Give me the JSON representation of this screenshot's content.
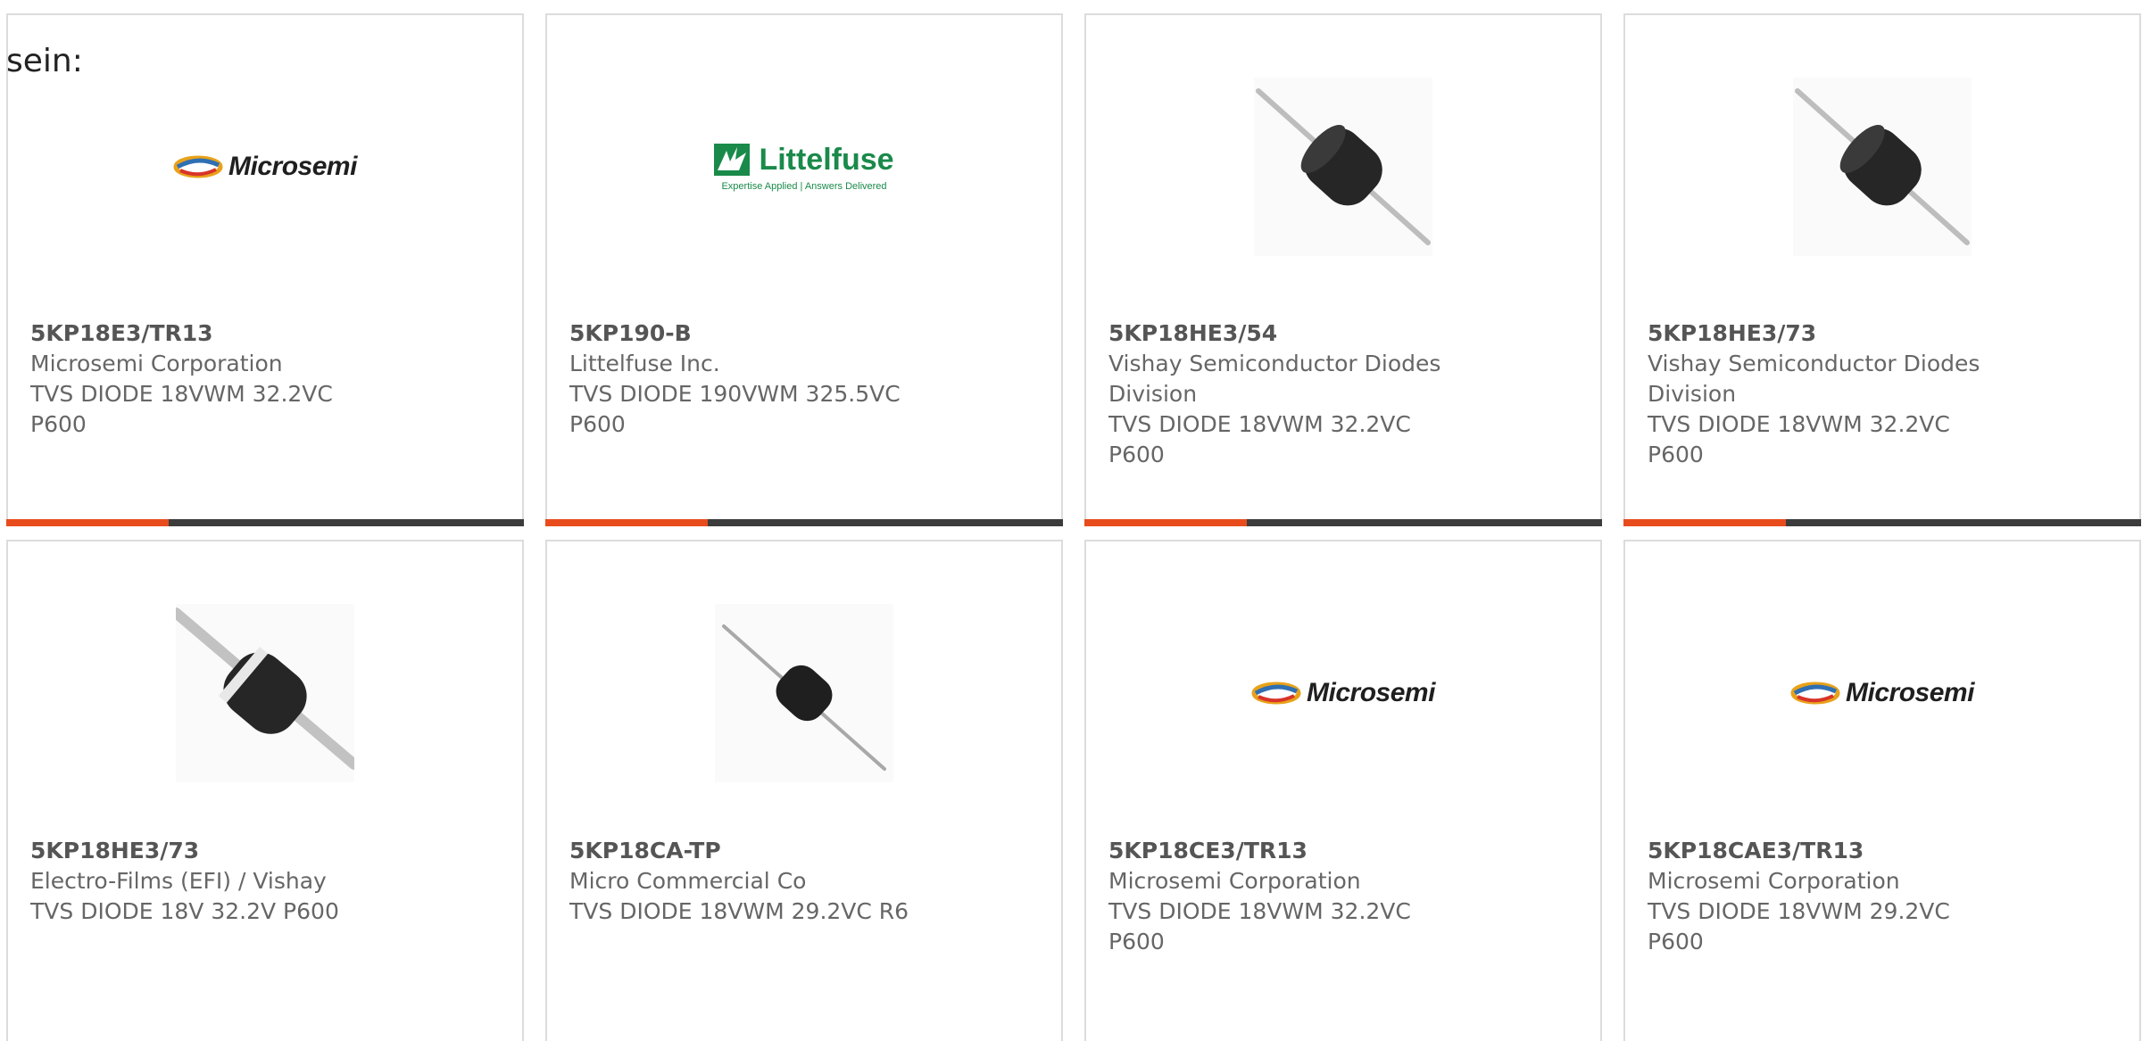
{
  "intro_text": "sein:",
  "colors": {
    "accent": "#e84c1d",
    "bar": "#3c3c3c",
    "border": "#dcdcdc",
    "text": "#666666"
  },
  "products": [
    {
      "part_number": "5KP18E3/TR13",
      "manufacturer": "Microsemi Corporation",
      "description": "TVS DIODE 18VWM 32.2VC P600",
      "image": "microsemi-logo",
      "logo_text": "Microsemi"
    },
    {
      "part_number": "5KP190-B",
      "manufacturer": "Littelfuse Inc.",
      "description": "TVS DIODE 190VWM 325.5VC P600",
      "image": "littelfuse-logo",
      "logo_text": "Littelfuse",
      "logo_tagline": "Expertise Applied | Answers Delivered"
    },
    {
      "part_number": "5KP18HE3/54",
      "manufacturer": "Vishay Semiconductor Diodes Division",
      "description": "TVS DIODE 18VWM 32.2VC P600",
      "image": "axial-diode-photo"
    },
    {
      "part_number": "5KP18HE3/73",
      "manufacturer": "Vishay Semiconductor Diodes Division",
      "description": "TVS DIODE 18VWM 32.2VC P600",
      "image": "axial-diode-photo"
    },
    {
      "part_number": "5KP18HE3/73",
      "manufacturer": "Electro-Films (EFI) / Vishay",
      "description": "TVS DIODE 18V 32.2V P600",
      "image": "axial-diode-band-photo"
    },
    {
      "part_number": "5KP18CA-TP",
      "manufacturer": "Micro Commercial Co",
      "description": "TVS DIODE 18VWM 29.2VC R6",
      "image": "axial-diode-small-photo"
    },
    {
      "part_number": "5KP18CE3/TR13",
      "manufacturer": "Microsemi Corporation",
      "description": "TVS DIODE 18VWM 32.2VC P600",
      "image": "microsemi-logo",
      "logo_text": "Microsemi"
    },
    {
      "part_number": "5KP18CAE3/TR13",
      "manufacturer": "Microsemi Corporation",
      "description": "TVS DIODE 18VWM 29.2VC P600",
      "image": "microsemi-logo",
      "logo_text": "Microsemi"
    }
  ]
}
